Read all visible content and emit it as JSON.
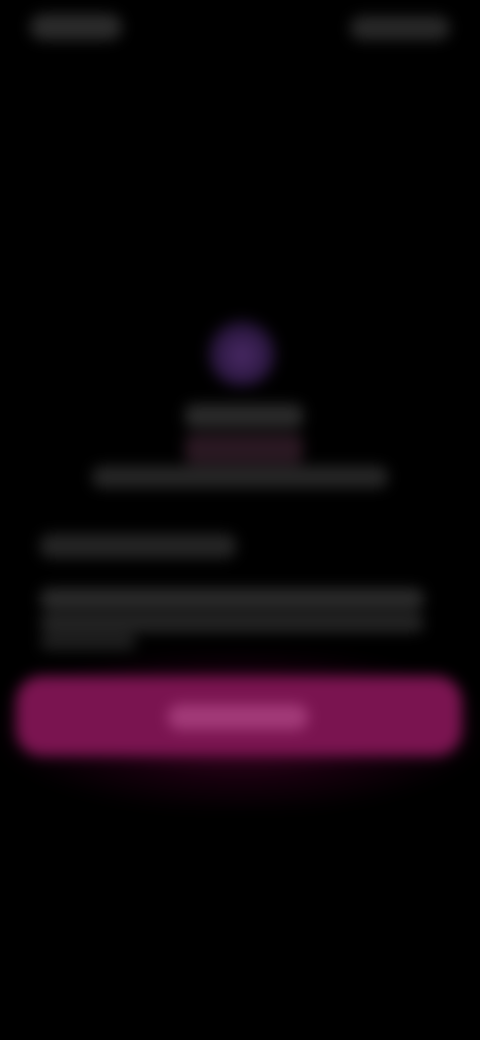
{
  "colors": {
    "background": "#000000",
    "accent": "#7a1450",
    "icon_tint": "#4a2a66"
  },
  "icons": {
    "app": "app-logo-icon"
  },
  "screen": {
    "state": "blurred"
  }
}
